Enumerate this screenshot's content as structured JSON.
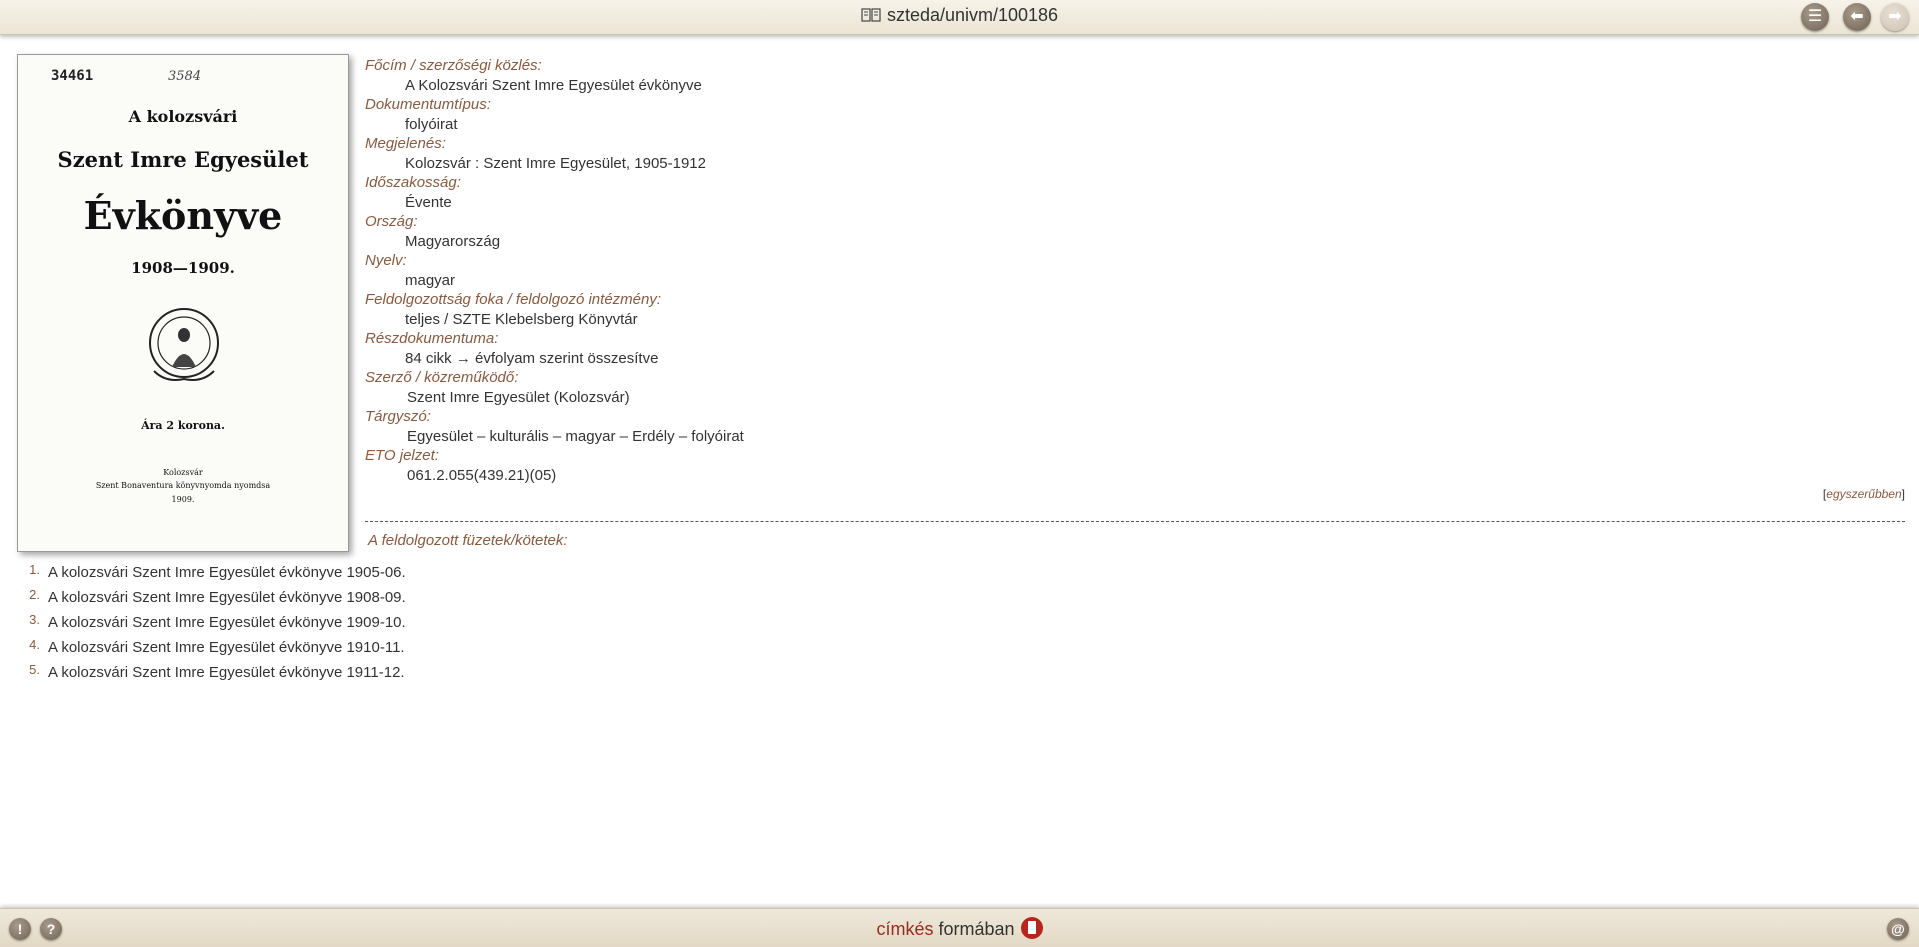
{
  "header": {
    "title": "szteda/univm/100186",
    "book_icon": "book-icon",
    "buttons": [
      {
        "name": "list-icon",
        "glyph": "☰"
      },
      {
        "name": "back-arrow-icon",
        "glyph": "⬅"
      },
      {
        "name": "forward-arrow-icon",
        "glyph": "➡"
      }
    ]
  },
  "cover": {
    "number": "34461",
    "handwriting": "3584",
    "line1": "A kolozsvári",
    "line2": "Szent Imre Egyesület",
    "line3": "Évkönyve",
    "line4": "1908—1909.",
    "line5": "Ára 2 korona.",
    "line6": "Kolozsvár",
    "line7": "Szent Bonaventura könyvnyomda nyomdsa",
    "line8": "1909."
  },
  "meta": {
    "title_label": "Főcím / szerzőségi közlés:",
    "title_value": "A Kolozsvári Szent Imre Egyesület évkönyve",
    "doctype_label": "Dokumentumtípus:",
    "doctype_value": "folyóirat",
    "published_label": "Megjelenés:",
    "published_value": "Kolozsvár : Szent Imre Egyesület, 1905-1912",
    "frequency_label": "Időszakosság:",
    "frequency_value": "Évente",
    "country_label": "Ország:",
    "country_value": "Magyarország",
    "language_label": "Nyelv:",
    "language_value": "magyar",
    "processing_label": "Feldolgozottság foka / feldolgozó intézmény:",
    "processing_value": "teljes / SZTE Klebelsberg Könyvtár",
    "parts_label": "Részdokumentuma:",
    "parts_value": "84 cikk → évfolyam szerint összesítve",
    "author_label": "Szerző / közreműködő:",
    "author_value": "Szent Imre Egyesület (Kolozsvár)",
    "subject_label": "Tárgyszó:",
    "subject_value": "Egyesület – kulturális – magyar – Erdély – folyóirat",
    "eto_label": "ETO jelzet:",
    "eto_value": "061.2.055(439.21)(05)"
  },
  "simple_link": {
    "open": "[",
    "label": "egyszerűbben",
    "close": "]"
  },
  "issues": {
    "title": "A feldolgozott füzetek/kötetek:",
    "items": [
      {
        "n": "1.",
        "text": "A kolozsvári Szent Imre Egyesület évkönyve 1905-06."
      },
      {
        "n": "2.",
        "text": "A kolozsvári Szent Imre Egyesület évkönyve 1908-09."
      },
      {
        "n": "3.",
        "text": "A kolozsvári Szent Imre Egyesület évkönyve 1909-10."
      },
      {
        "n": "4.",
        "text": "A kolozsvári Szent Imre Egyesület évkönyve 1910-11."
      },
      {
        "n": "5.",
        "text": "A kolozsvári Szent Imre Egyesület évkönyve 1911-12."
      }
    ]
  },
  "footer": {
    "left_buttons": [
      {
        "name": "info-icon",
        "glyph": "!"
      },
      {
        "name": "help-icon",
        "glyph": "?"
      }
    ],
    "label_a": "címkés",
    "label_b": " formában",
    "document_icon": "document-icon",
    "at_glyph": "@"
  }
}
